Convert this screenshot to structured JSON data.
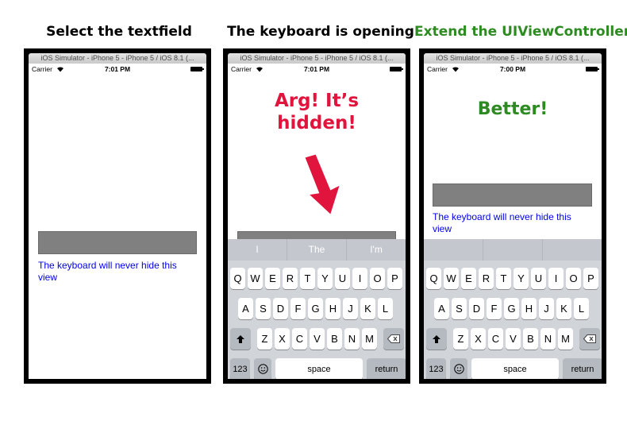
{
  "panels": [
    {
      "heading": "Select the textfield",
      "window_title": "iOS Simulator - iPhone 5 - iPhone 5 / iOS 8.1 (...",
      "carrier": "Carrier",
      "time": "7:01 PM",
      "label": "The keyboard will never hide this view"
    },
    {
      "heading": "The keyboard is opening",
      "window_title": "iOS Simulator - iPhone 5 - iPhone 5 / iOS 8.1 (...",
      "carrier": "Carrier",
      "time": "7:01 PM",
      "callout": "Arg! It’s hidden!",
      "suggestions": [
        "I",
        "The",
        "I'm"
      ]
    },
    {
      "heading": "Extend the UIViewController",
      "window_title": "iOS Simulator - iPhone 5 - iPhone 5 / iOS 8.1 (...",
      "carrier": "Carrier",
      "time": "7:00 PM",
      "callout": "Better!",
      "label": "The keyboard will never hide this view",
      "suggestions": [
        "",
        "",
        ""
      ]
    }
  ],
  "keyboard": {
    "row1": [
      "Q",
      "W",
      "E",
      "R",
      "T",
      "Y",
      "U",
      "I",
      "O",
      "P"
    ],
    "row2": [
      "A",
      "S",
      "D",
      "F",
      "G",
      "H",
      "J",
      "K",
      "L"
    ],
    "row3": [
      "Z",
      "X",
      "C",
      "V",
      "B",
      "N",
      "M"
    ],
    "numbers_label": "123",
    "space_label": "space",
    "return_label": "return"
  },
  "icons": {
    "wifi": "wifi-icon",
    "battery": "battery-icon",
    "shift": "shift-arrow-icon",
    "delete": "backspace-icon",
    "emoji": "emoji-icon",
    "arrow": "red-down-arrow-icon"
  },
  "colors": {
    "red_callout": "#e0143c",
    "green_callout": "#2e8b22",
    "link_blue": "#0000ee",
    "textfield_gray": "#808080"
  }
}
